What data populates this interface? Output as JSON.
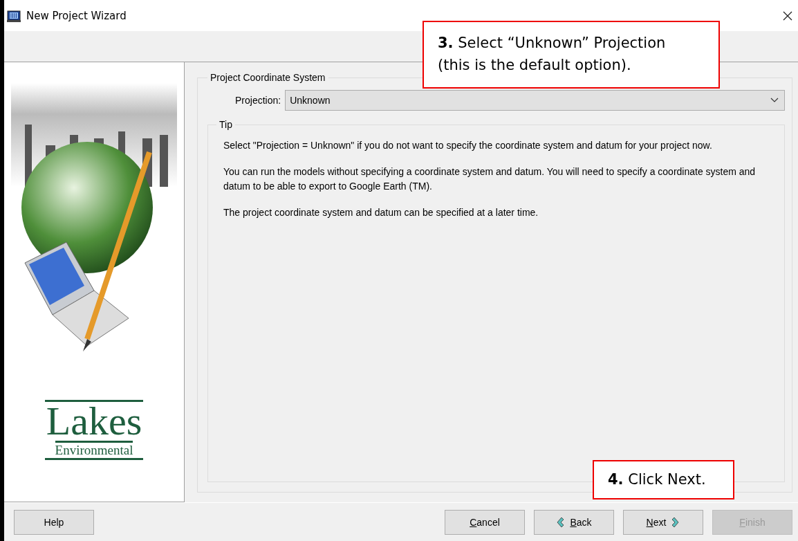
{
  "window": {
    "title": "New Project Wizard"
  },
  "side_panel": {
    "logo_word": "Lakes",
    "logo_subtitle": "Environmental"
  },
  "group": {
    "title": "Project Coordinate System",
    "projection": {
      "label": "Projection:",
      "value": "Unknown"
    },
    "tip": {
      "title": "Tip",
      "paragraphs": [
        "Select \"Projection = Unknown\" if you do not want to specify the coordinate system and datum for your project now.",
        "You can run the models without specifying a coordinate system and datum. You will need to specify a coordinate system and datum to be able to export to Google Earth (TM).",
        "The project coordinate system and datum can be specified at a later time."
      ]
    }
  },
  "buttons": [
    {
      "kind": "help",
      "label": "Help",
      "disabled": false
    },
    {
      "kind": "cancel",
      "mnemonic": "C",
      "label": "ancel",
      "disabled": false
    },
    {
      "kind": "back",
      "mnemonic": "B",
      "label": "ack",
      "disabled": false
    },
    {
      "kind": "next",
      "mnemonic": "N",
      "label": "ext",
      "disabled": false
    },
    {
      "kind": "finish",
      "mnemonic": "F",
      "label": "inish",
      "disabled": true
    }
  ],
  "callouts": [
    {
      "kind": "top",
      "text": "**3.**  Select “Unknown” Projection (this is the default option)."
    },
    {
      "kind": "bottom",
      "text": "**4.**  Click Next."
    }
  ]
}
